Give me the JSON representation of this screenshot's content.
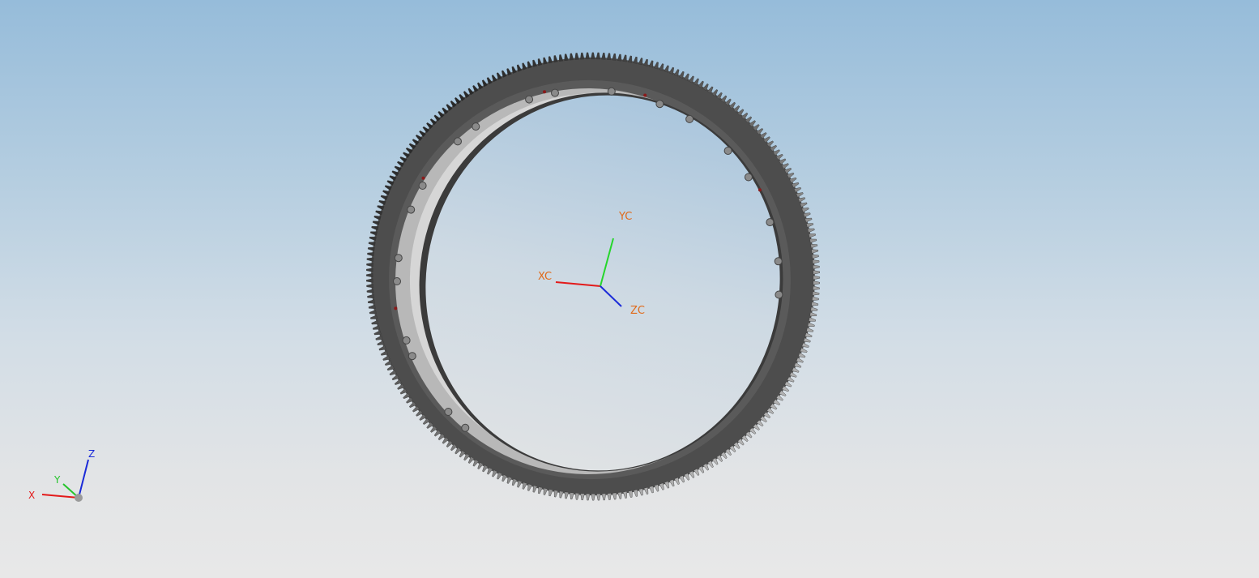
{
  "viewport": {
    "background_top": "#96bcda",
    "background_bottom": "#e8e8e8"
  },
  "model": {
    "name": "gear-ring",
    "tooth_count": 260,
    "color_dark": "#3f3f3f",
    "color_light": "#c9c9c9",
    "hole_color": "#8a8a8a",
    "marker_color": "#8b1a1a"
  },
  "wcs": {
    "x_label": "XC",
    "y_label": "YC",
    "z_label": "ZC",
    "label_color": "#e06a1a",
    "x_color": "#e31a1a",
    "y_color": "#25d62b",
    "z_color": "#1a2ad8"
  },
  "absolute_triad": {
    "x_label": "X",
    "y_label": "Y",
    "z_label": "Z",
    "x_color": "#e31a1a",
    "y_color": "#25c42b",
    "z_color": "#1a2ad8",
    "origin_color": "#9a9a9a"
  }
}
